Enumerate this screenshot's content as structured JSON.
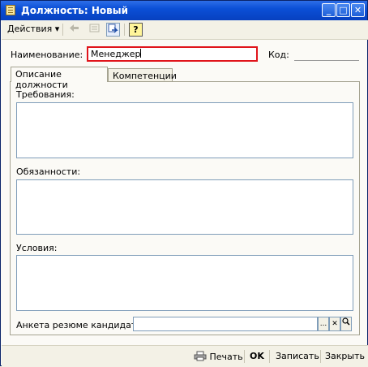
{
  "window": {
    "title": "Должность: Новый",
    "controls": {
      "minimize": "_",
      "maximize": "□",
      "close": "✕"
    }
  },
  "toolbar": {
    "actions_label": "Действия",
    "actions_arrow": "▾",
    "help_label": "?"
  },
  "header": {
    "name_label": "Наименование:",
    "name_value": "Менеджер",
    "code_label": "Код:",
    "code_value": ""
  },
  "tabs": [
    {
      "label": "Описание должности",
      "active": true
    },
    {
      "label": "Компетенции",
      "active": false
    }
  ],
  "description_tab": {
    "requirements_label": "Требования:",
    "requirements_value": "",
    "duties_label": "Обязанности:",
    "duties_value": "",
    "conditions_label": "Условия:",
    "conditions_value": "",
    "questionnaire_label": "Анкета резюме кандидата:",
    "questionnaire_value": "",
    "select_button": "...",
    "clear_button": "✕",
    "open_button": "🔍"
  },
  "footer": {
    "print_label": "Печать",
    "ok_label": "OK",
    "save_label": "Записать",
    "close_label": "Закрыть"
  },
  "colors": {
    "titlebar": "#0b4fd6",
    "active_field_border": "#e0141b",
    "field_border": "#7f9db9",
    "window_bg": "#fbfaf6"
  }
}
